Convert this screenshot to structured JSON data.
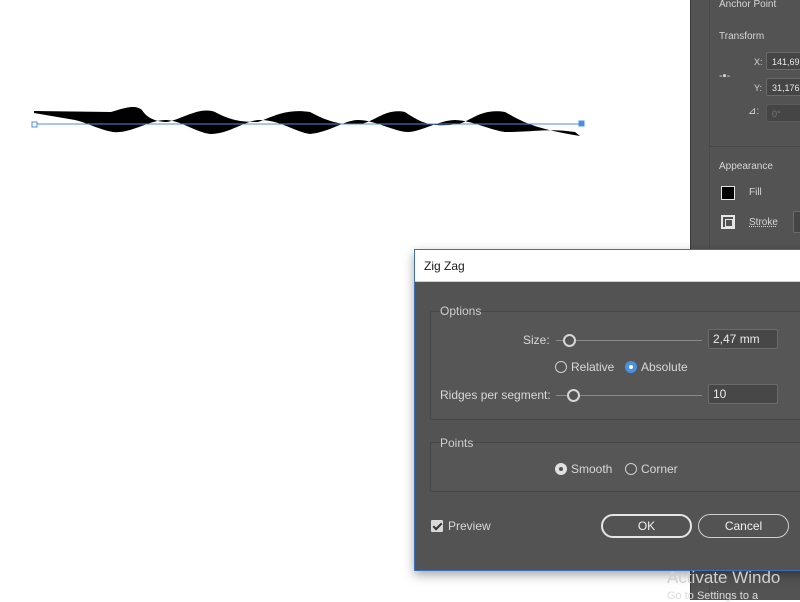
{
  "panel": {
    "anchor_point_label": "Anchor Point",
    "transform_label": "Transform",
    "x_label": "X:",
    "x_value": "141,69",
    "y_label": "Y:",
    "y_value": "31,176",
    "angle_label": "⊿:",
    "angle_value": "0°",
    "appearance_label": "Appearance",
    "fill_label": "Fill",
    "stroke_label": "Stroke",
    "fill_color": "#000000"
  },
  "dialog": {
    "title": "Zig Zag",
    "options_label": "Options",
    "size_label": "Size:",
    "size_value": "2,47 mm",
    "relative_label": "Relative",
    "absolute_label": "Absolute",
    "ridges_label": "Ridges per segment:",
    "ridges_value": "10",
    "points_label": "Points",
    "smooth_label": "Smooth",
    "corner_label": "Corner",
    "preview_label": "Preview",
    "ok_label": "OK",
    "cancel_label": "Cancel",
    "size_slider_level": 0.07,
    "ridges_slider_level": 0.1,
    "selected_size_mode": "Absolute",
    "selected_point_type": "Smooth",
    "preview_checked": true,
    "accent_color": "#4a90e2"
  },
  "watermark": {
    "line1": "Activate Windo",
    "line2": "Go to Settings to a"
  }
}
